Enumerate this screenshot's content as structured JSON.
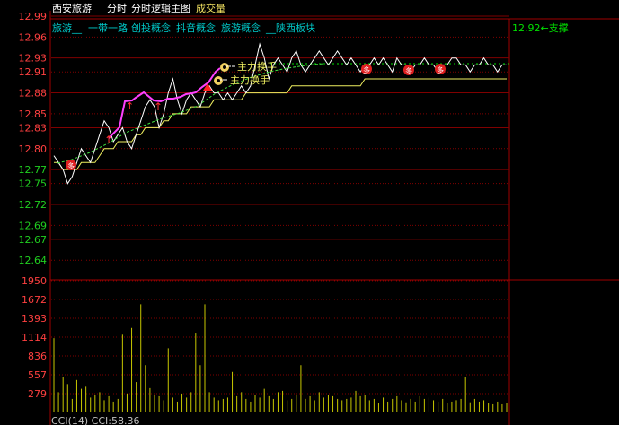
{
  "header": {
    "stock_name": "西安旅游",
    "tabs": [
      "分时",
      "分时逻辑主图",
      "成交量"
    ],
    "concepts": [
      "旅游__",
      "一带一路",
      "创投概念",
      "抖音概念",
      "旅游概念",
      "__陕西板块"
    ]
  },
  "annotations": {
    "support_label": "12.92←支撑",
    "flow_label_1": "主力换手",
    "flow_label_2": "主力换手",
    "signal_badge": "多",
    "indicator_text": "CCI(14)  CCI:58.36"
  },
  "colors": {
    "price_up": "#ff3c3c",
    "volume_label": "#c8c800",
    "concept_text": "#00c8c8",
    "price_line": "#ffffff",
    "avg_line": "#f0f060",
    "trend_line": "#ff40ff",
    "support_line": "#00e000"
  },
  "chart_data": [
    {
      "type": "line",
      "title": "",
      "y_ticks": [
        "12.99",
        "12.96",
        "12.93",
        "12.91",
        "12.88",
        "12.85",
        "12.83",
        "12.80",
        "12.77",
        "12.75",
        "12.72",
        "12.69",
        "12.67",
        "12.64"
      ],
      "ylim": [
        12.63,
        12.99
      ],
      "series": [
        {
          "values": [
            12.79,
            12.78,
            12.77,
            12.75,
            12.76,
            12.78,
            12.8,
            12.79,
            12.78,
            12.8,
            12.82,
            12.84,
            12.83,
            12.81,
            12.82,
            12.83,
            12.81,
            12.8,
            12.82,
            12.84,
            12.86,
            12.87,
            12.86,
            12.83,
            12.85,
            12.88,
            12.9,
            12.87,
            12.85,
            12.87,
            12.88,
            12.87,
            12.86,
            12.88,
            12.89,
            12.88,
            12.88,
            12.87,
            12.88,
            12.87,
            12.88,
            12.89,
            12.88,
            12.89,
            12.92,
            12.95,
            12.93,
            12.9,
            12.92,
            12.93,
            12.92,
            12.91,
            12.93,
            12.94,
            12.92,
            12.91,
            12.92,
            12.93,
            12.94,
            12.93,
            12.92,
            12.93,
            12.94,
            12.93,
            12.92,
            12.93,
            12.92,
            12.91,
            12.92,
            12.92,
            12.93,
            12.92,
            12.93,
            12.92,
            12.91,
            12.93,
            12.92,
            12.92,
            12.91,
            12.92,
            12.92,
            12.93,
            12.92,
            12.92,
            12.91,
            12.92,
            12.92,
            12.93,
            12.93,
            12.92,
            12.92,
            12.91,
            12.92,
            12.92,
            12.93,
            12.92,
            12.92,
            12.91,
            12.92,
            12.92
          ]
        },
        {
          "values": [
            12.78,
            12.78,
            12.77,
            12.77,
            12.77,
            12.77,
            12.78,
            12.78,
            12.78,
            12.78,
            12.79,
            12.8,
            12.8,
            12.8,
            12.81,
            12.81,
            12.81,
            12.81,
            12.82,
            12.82,
            12.83,
            12.83,
            12.83,
            12.83,
            12.84,
            12.84,
            12.85,
            12.85,
            12.85,
            12.85,
            12.86,
            12.86,
            12.86,
            12.86,
            12.86,
            12.87,
            12.87,
            12.87,
            12.87,
            12.87,
            12.87,
            12.87,
            12.88,
            12.88,
            12.88,
            12.88,
            12.88,
            12.88,
            12.88,
            12.88,
            12.88,
            12.88,
            12.89,
            12.89,
            12.89,
            12.89,
            12.89,
            12.89,
            12.89,
            12.89,
            12.89,
            12.89,
            12.89,
            12.89,
            12.89,
            12.89,
            12.89,
            12.89,
            12.9,
            12.9,
            12.9,
            12.9,
            12.9,
            12.9,
            12.9,
            12.9,
            12.9,
            12.9,
            12.9,
            12.9,
            12.9,
            12.9,
            12.9,
            12.9,
            12.9,
            12.9,
            12.9,
            12.9,
            12.9,
            12.9,
            12.9,
            12.9,
            12.9,
            12.9,
            12.9,
            12.9,
            12.9,
            12.9,
            12.9,
            12.9
          ]
        }
      ]
    },
    {
      "type": "bar",
      "title": "",
      "y_ticks": [
        "1950",
        "1672",
        "1393",
        "1114",
        "836",
        "557",
        "279"
      ],
      "ylim": [
        0,
        1950
      ],
      "values": [
        1100,
        300,
        520,
        420,
        200,
        480,
        350,
        380,
        220,
        260,
        300,
        180,
        240,
        160,
        200,
        1150,
        280,
        1250,
        450,
        1600,
        700,
        360,
        260,
        240,
        180,
        950,
        220,
        160,
        280,
        220,
        300,
        1180,
        700,
        1600,
        300,
        220,
        180,
        200,
        220,
        600,
        240,
        300,
        200,
        160,
        260,
        220,
        350,
        240,
        200,
        300,
        320,
        180,
        200,
        260,
        700,
        200,
        240,
        180,
        300,
        220,
        260,
        240,
        200,
        180,
        200,
        220,
        320,
        240,
        260,
        180,
        200,
        140,
        220,
        160,
        200,
        240,
        180,
        150,
        200,
        160,
        240,
        200,
        220,
        180,
        160,
        200,
        140,
        160,
        180,
        200,
        520,
        150,
        200,
        160,
        180,
        140,
        120,
        160,
        120,
        140
      ]
    }
  ]
}
